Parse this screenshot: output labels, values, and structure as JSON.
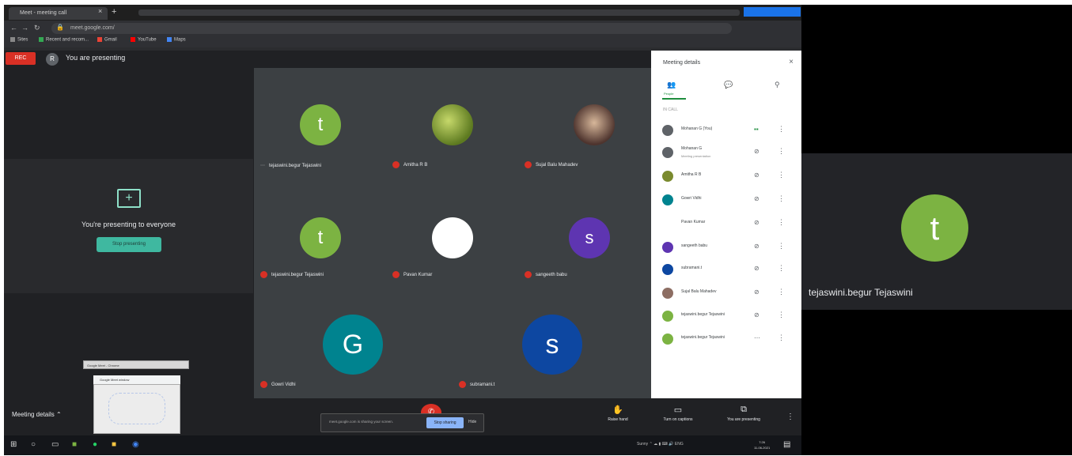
{
  "browser": {
    "tab_title": "Meet - meeting call",
    "url": "meet.google.com/",
    "bookmarks": [
      "Sites",
      "Recent and recom...",
      "Gmail",
      "YouTube",
      "Maps"
    ]
  },
  "meeting": {
    "rec_label": "REC",
    "presenting_initial": "R",
    "presenting_banner": "You are presenting",
    "present_message": "You're presenting to everyone",
    "stop_presenting_label": "Stop presenting"
  },
  "tiles": [
    {
      "name": "tejaswini.begur Tejaswini",
      "initial": "t",
      "color": "#7cb342",
      "muted": false
    },
    {
      "name": "Amitha R B",
      "initial": "",
      "color": "#7a8a2e",
      "muted": true
    },
    {
      "name": "Sujal Balu Mahadev",
      "initial": "",
      "color": "#8d6e63",
      "muted": true
    },
    {
      "name": "tejaswini.begur Tejaswini",
      "initial": "t",
      "color": "#7cb342",
      "muted": true
    },
    {
      "name": "Pavan Kumar",
      "initial": "",
      "color": "#ffffff",
      "muted": true
    },
    {
      "name": "sangeeth babu",
      "initial": "s",
      "color": "#5e35b1",
      "muted": true
    },
    {
      "name": "Gowri Vidhi",
      "initial": "G",
      "color": "#00838f",
      "muted": true
    },
    {
      "name": "subramani.t",
      "initial": "s",
      "color": "#0d47a1",
      "muted": true
    }
  ],
  "side_panel": {
    "title": "Meeting details",
    "people_tab": "People",
    "chat_icon": "chat-icon",
    "section_label": "IN CALL",
    "participants": [
      {
        "name": "Mohanan G (You)",
        "sub": "",
        "color": "#5f6368"
      },
      {
        "name": "Mohanan G",
        "sub": "Meeting presentation",
        "color": "#5f6368"
      },
      {
        "name": "Amitha R B",
        "sub": "",
        "color": "#7a8a2e"
      },
      {
        "name": "Gowri Vidhi",
        "sub": "",
        "color": "#00838f"
      },
      {
        "name": "Pavan Kumar",
        "sub": "",
        "color": "#ffffff"
      },
      {
        "name": "sangeeth babu",
        "sub": "",
        "color": "#5e35b1"
      },
      {
        "name": "subramani.t",
        "sub": "",
        "color": "#0d47a1"
      },
      {
        "name": "Sujal Balu Mahadev",
        "sub": "",
        "color": "#8d6e63"
      },
      {
        "name": "tejaswini.begur Tejaswini",
        "sub": "",
        "color": "#7cb342"
      },
      {
        "name": "tejaswini.begur Tejaswini",
        "sub": "",
        "color": "#7cb342"
      }
    ]
  },
  "bottom_bar": {
    "meeting_details": "Meeting details",
    "raise_hand": "Raise hand",
    "captions": "Turn on captions",
    "present_now": "You are presenting"
  },
  "notification": {
    "text": "meet.google.com is sharing your screen.",
    "stop_label": "Stop sharing",
    "hide_label": "Hide"
  },
  "thumbnail": {
    "title": "Google Meet - Chrome",
    "bar": "Google Meet window"
  },
  "taskbar": {
    "clock_time": "7:26",
    "clock_date": "11-06-2021",
    "weather": "Sunny"
  },
  "right_tile": {
    "initial": "t",
    "name": "tejaswini.begur Tejaswini"
  }
}
